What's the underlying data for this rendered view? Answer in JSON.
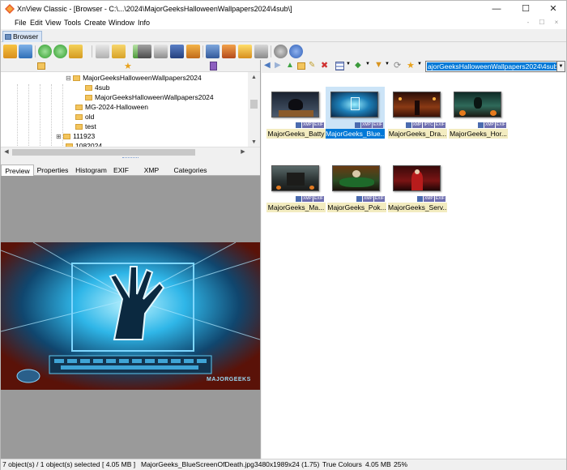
{
  "window": {
    "title": "XnView Classic - [Browser - C:\\...\\2024\\MajorGeeksHalloweenWallpapers2024\\4sub\\]",
    "minimize_glyph": "—",
    "maximize_glyph": "☐",
    "close_glyph": "✕"
  },
  "menu": {
    "items": [
      "File",
      "Edit",
      "View",
      "Tools",
      "Create",
      "Window",
      "Info"
    ],
    "right_glyphs": [
      "-",
      "☐",
      "×"
    ]
  },
  "tab": {
    "label": "Browser"
  },
  "tree": {
    "items": [
      {
        "label": "MajorGeeksHalloweenWallpapers2024",
        "expand": "⊟"
      },
      {
        "label": "4sub"
      },
      {
        "label": "MajorGeeksHalloweenWallpapers2024"
      },
      {
        "label": "MG-2024-Halloween"
      },
      {
        "label": "old"
      },
      {
        "label": "test"
      },
      {
        "label": "111923",
        "expand": "⊞"
      },
      {
        "label": "1082024"
      }
    ]
  },
  "preview_tabs": [
    "Preview",
    "Properties",
    "Histogram",
    "EXIF",
    "XMP",
    "Categories"
  ],
  "preview": {
    "watermark": "MAJORGEEKS"
  },
  "address": {
    "path": "ajorGeeksHalloweenWallpapers2024\\4sub\\"
  },
  "thumbnails": [
    {
      "label": "MajorGeeks_Batty",
      "badges": [
        "XMP",
        "EXIF"
      ],
      "selected": false
    },
    {
      "label": "MajorGeeks_Blue...",
      "badges": [
        "XMP",
        "EXIF"
      ],
      "selected": true
    },
    {
      "label": "MajorGeeks_Dra...",
      "badges": [
        "XMP",
        "IPTC",
        "EXIF"
      ],
      "selected": false
    },
    {
      "label": "MajorGeeks_Hor...",
      "badges": [
        "XMP",
        "EXIF"
      ],
      "selected": false
    },
    {
      "label": "MajorGeeks_Ma...",
      "badges": [
        "XMP",
        "EXIF"
      ],
      "selected": false
    },
    {
      "label": "MajorGeeks_Pok...",
      "badges": [
        "XMP",
        "EXIF"
      ],
      "selected": false
    },
    {
      "label": "MajorGeeks_Serv...",
      "badges": [
        "XMP",
        "EXIF"
      ],
      "selected": false
    }
  ],
  "status": {
    "selection": "7 object(s) / 1 object(s) selected",
    "size": "[ 4.05 MB ]",
    "filename": "MajorGeeks_BlueScreenOfDeath.jpg",
    "dimensions": "3480x1989x24 (1.75)",
    "colours": "True Colours",
    "filesize": "4.05 MB",
    "zoom": "25%"
  },
  "colors": {
    "selection": "#0078d7",
    "label_bg": "#f3ecc0",
    "preview_bg": "#9a9a9a"
  }
}
